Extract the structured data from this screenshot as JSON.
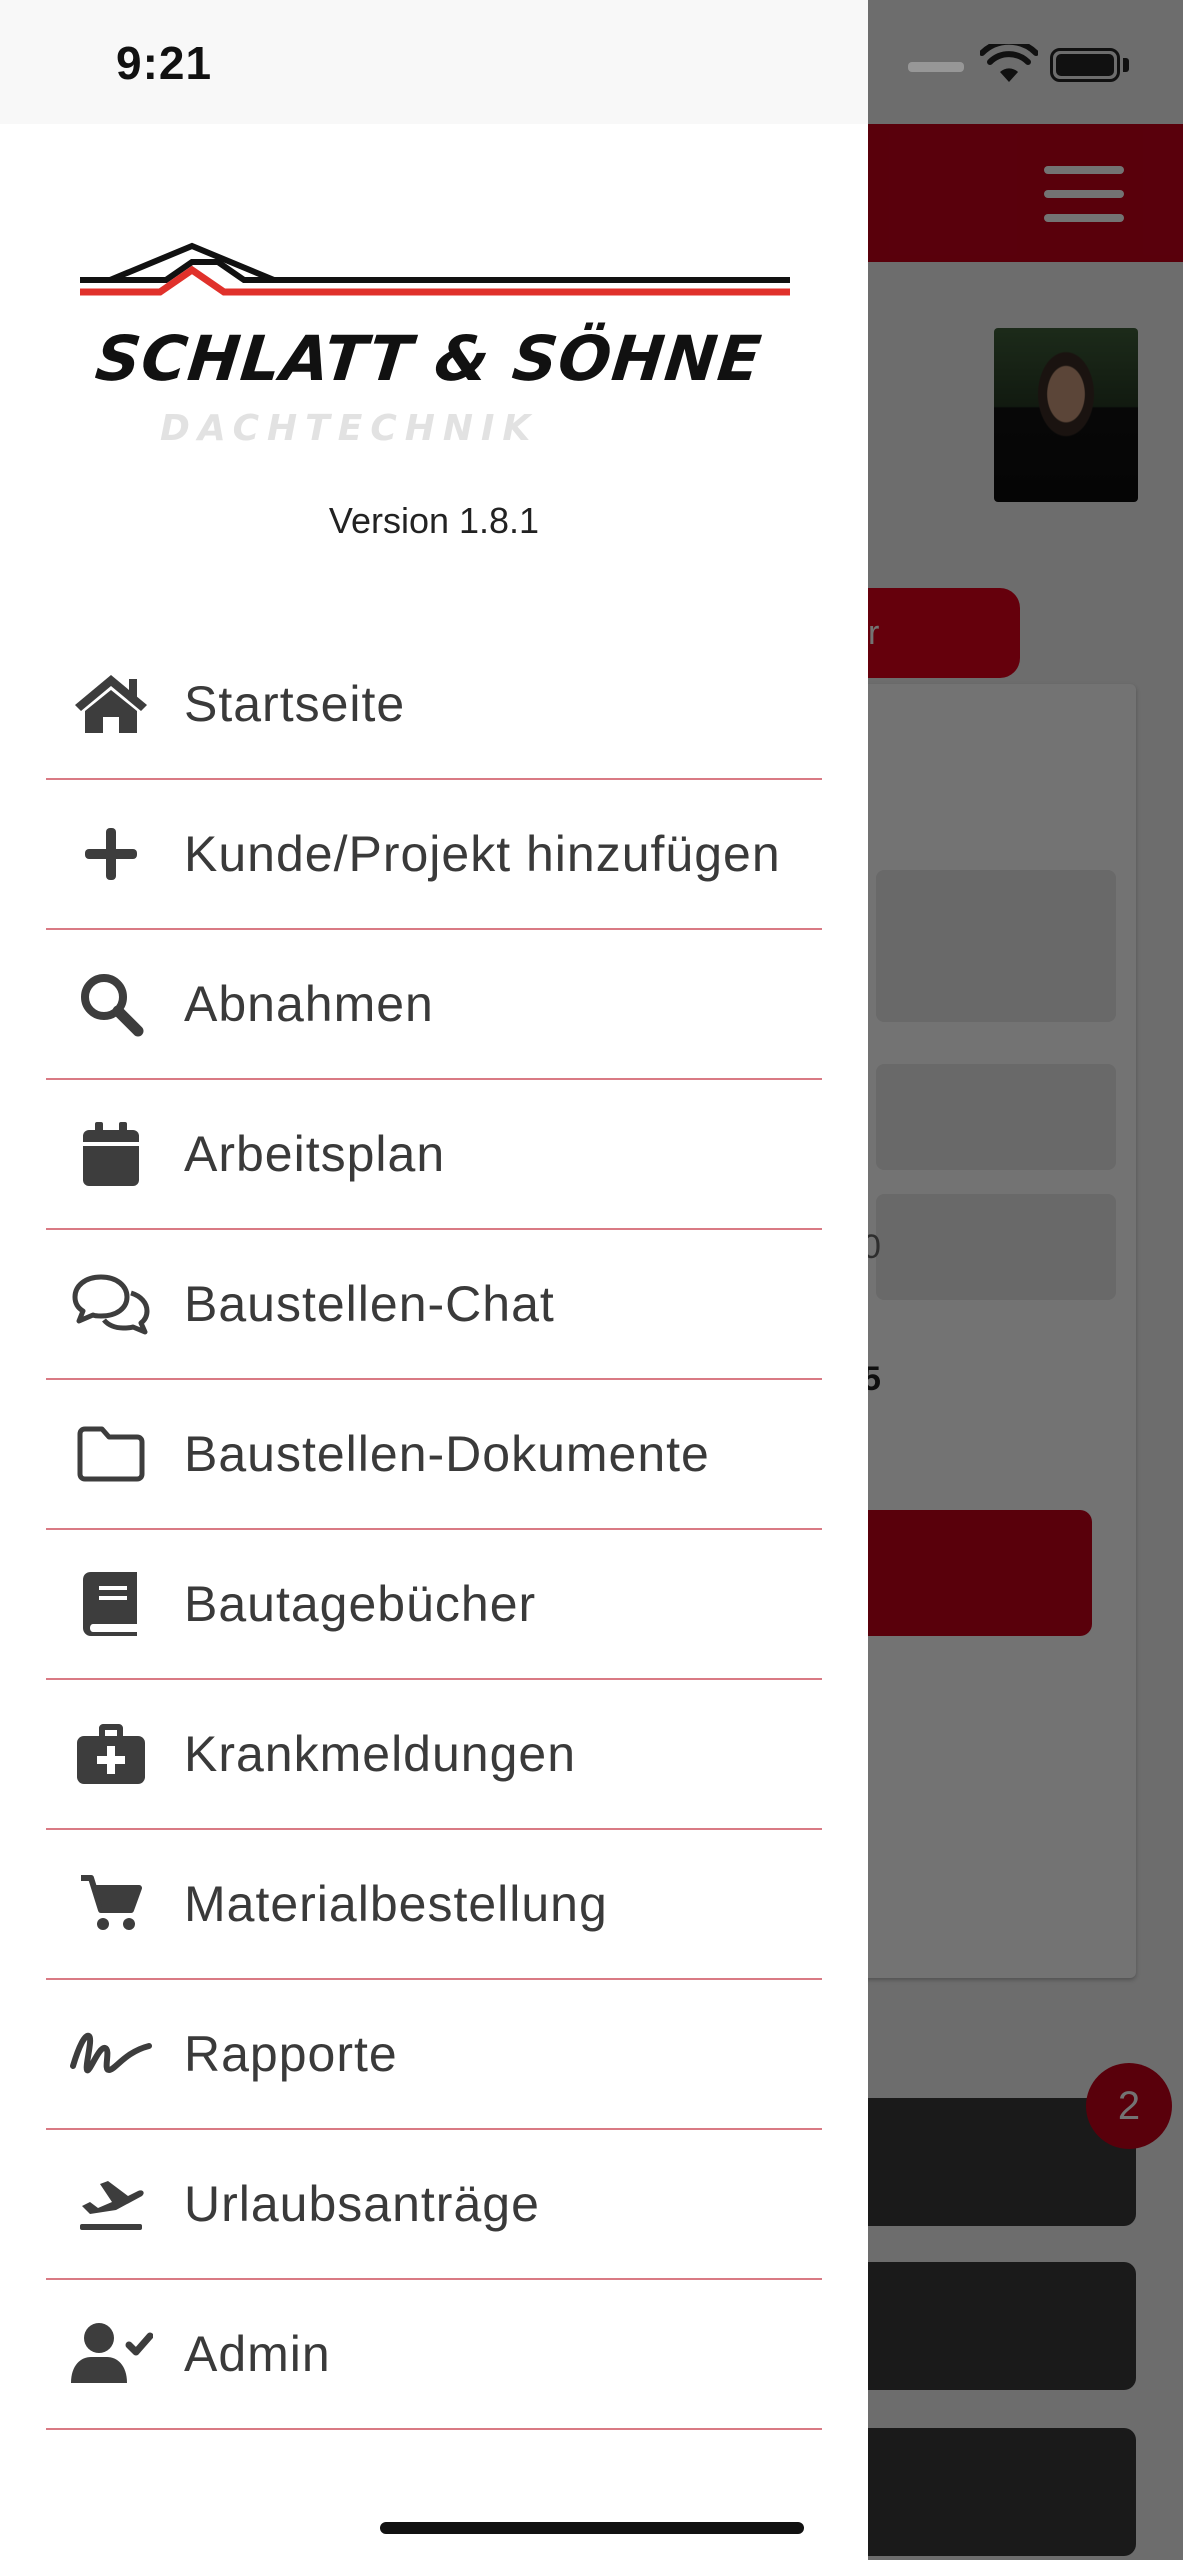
{
  "status_bar": {
    "time": "9:21"
  },
  "app": {
    "company_name": "SCHLATT & SÖHNE",
    "company_subtitle": "DACHTECHNIK",
    "version": "Version 1.8.1"
  },
  "menu": {
    "items": [
      {
        "label": "Startseite",
        "icon": "home-icon"
      },
      {
        "label": "Kunde/Projekt hinzufügen",
        "icon": "plus-icon"
      },
      {
        "label": "Abnahmen",
        "icon": "search-icon"
      },
      {
        "label": "Arbeitsplan",
        "icon": "calendar-icon"
      },
      {
        "label": "Baustellen-Chat",
        "icon": "chat-icon"
      },
      {
        "label": "Baustellen-Dokumente",
        "icon": "folder-icon"
      },
      {
        "label": "Bautagebücher",
        "icon": "book-icon"
      },
      {
        "label": "Krankmeldungen",
        "icon": "medical-case-icon"
      },
      {
        "label": "Materialbestellung",
        "icon": "cart-icon"
      },
      {
        "label": "Rapporte",
        "icon": "signature-icon"
      },
      {
        "label": "Urlaubsanträge",
        "icon": "plane-departure-icon"
      },
      {
        "label": "Admin",
        "icon": "user-check-icon"
      }
    ]
  },
  "background": {
    "button_fragment": "r",
    "field_fragment": "0",
    "value_fragment": "5",
    "badge_count": "2"
  },
  "colors": {
    "accent": "#c6001a",
    "divider": "#d97a84",
    "menu_text": "#3a3a3a",
    "menu_icon": "#3d3d3d"
  }
}
